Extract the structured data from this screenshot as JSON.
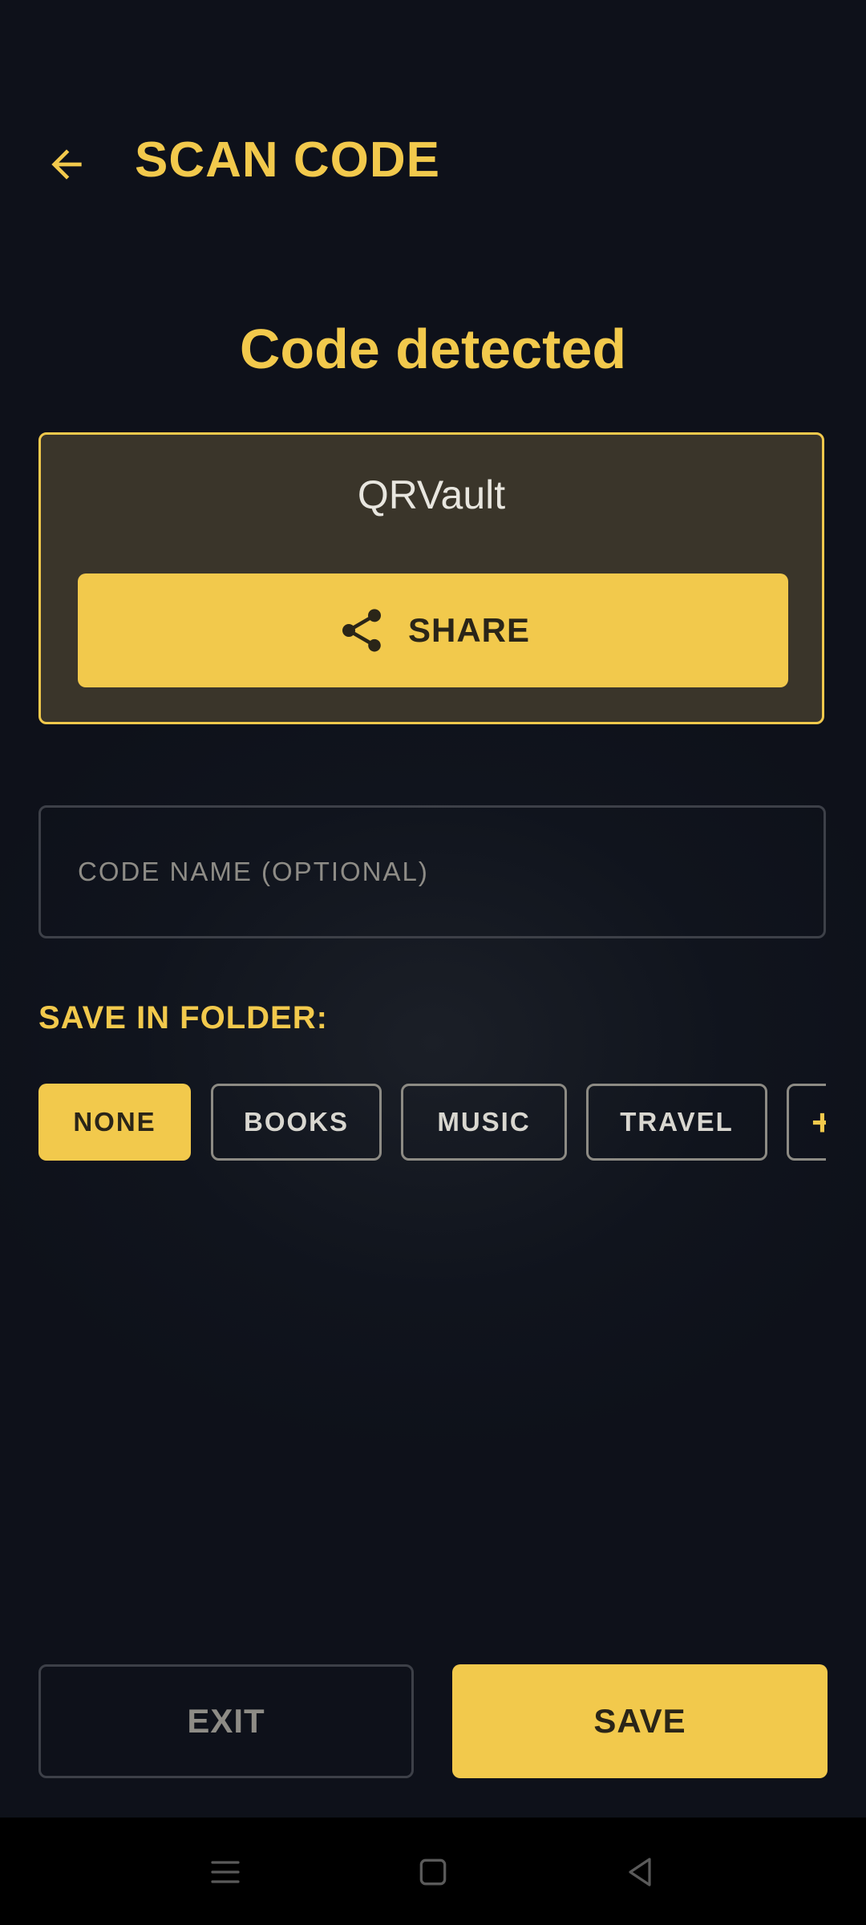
{
  "header": {
    "back_icon": "arrow-left-icon",
    "title": "SCAN CODE"
  },
  "result": {
    "heading": "Code detected",
    "code_value": "QRVault",
    "share_icon": "share-icon",
    "share_label": "SHARE"
  },
  "name_field": {
    "placeholder": "CODE NAME (OPTIONAL)",
    "value": ""
  },
  "folders": {
    "label": "SAVE IN FOLDER:",
    "selected": "NONE",
    "options": [
      "NONE",
      "BOOKS",
      "MUSIC",
      "TRAVEL"
    ],
    "add_label": "+"
  },
  "actions": {
    "exit_label": "EXIT",
    "save_label": "SAVE"
  },
  "system_nav": {
    "icons": [
      "menu-icon",
      "home-icon",
      "back-triangle-icon"
    ]
  },
  "colors": {
    "accent": "#f2c94c",
    "background": "#0e111a",
    "card": "#3a352a"
  }
}
